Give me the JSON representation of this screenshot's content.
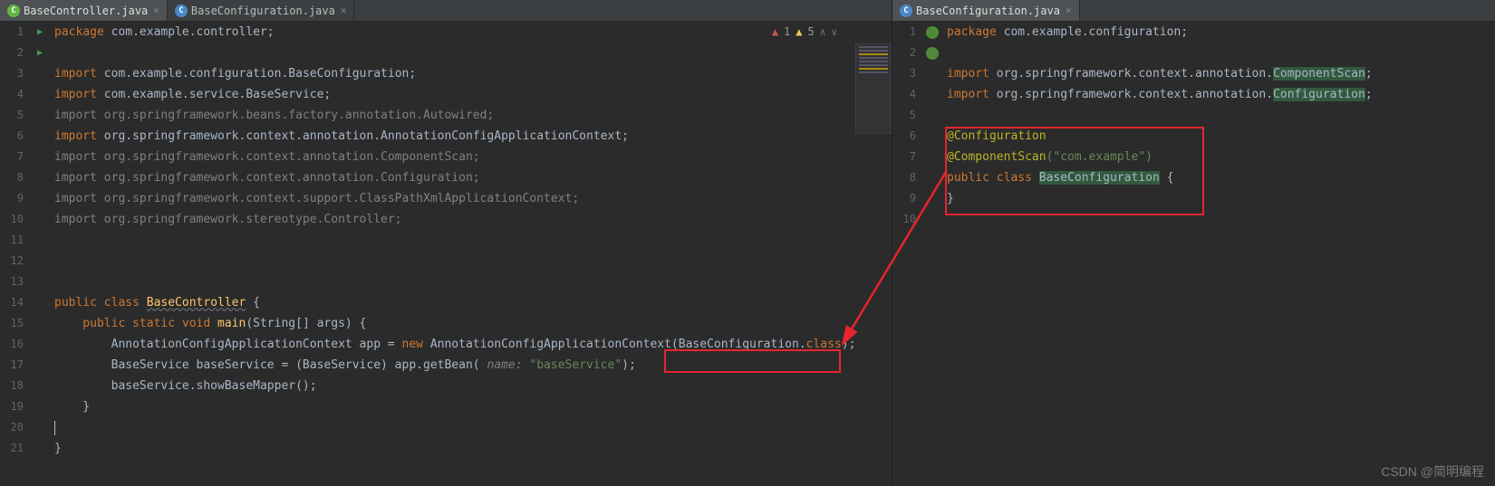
{
  "watermark": "CSDN @简明编程",
  "left": {
    "tabs": [
      {
        "label": "BaseController.java",
        "icon": "green",
        "active": true
      },
      {
        "label": "BaseConfiguration.java",
        "icon": "blue",
        "active": false
      }
    ],
    "warnings": {
      "errors": "1",
      "warns": "5"
    },
    "gutter": [
      "1",
      "2",
      "3",
      "4",
      "5",
      "6",
      "7",
      "8",
      "9",
      "10",
      "11",
      "12",
      "13",
      "14",
      "15",
      "16",
      "17",
      "18",
      "19",
      "20",
      "21"
    ],
    "lines": {
      "l1_kw": "package",
      "l1_rest": " com.example.controller;",
      "l3_kw": "import",
      "l3_rest": " com.example.configuration.BaseConfiguration;",
      "l4_kw": "import",
      "l4_rest": " com.example.service.BaseService;",
      "l5": "import org.springframework.beans.factory.annotation.Autowired;",
      "l6_kw": "import",
      "l6_rest": " org.springframework.context.annotation.AnnotationConfigApplicationContext;",
      "l7": "import org.springframework.context.annotation.ComponentScan;",
      "l8": "import org.springframework.context.annotation.Configuration;",
      "l9": "import org.springframework.context.support.ClassPathXmlApplicationContext;",
      "l10": "import org.springframework.stereotype.Controller;",
      "l14_pub": "public class ",
      "l14_cls": "BaseController",
      "l14_end": " {",
      "l15_pub": "    public static void ",
      "l15_main": "main",
      "l15_args": "(String[] args) {",
      "l16_a": "        AnnotationConfigApplicationContext app = ",
      "l16_new": "new",
      "l16_b": " AnnotationConfigApplicationContext(BaseConfiguration.",
      "l16_cls": "class",
      "l16_c": ");",
      "l17_a": "        BaseService baseService = (BaseService) app.getBean( ",
      "l17_p": "name:",
      "l17_s": " \"baseService\"",
      "l17_e": ");",
      "l18": "        baseService.showBaseMapper();",
      "l19": "    }",
      "l21": "}"
    }
  },
  "right": {
    "tabs": [
      {
        "label": "BaseConfiguration.java",
        "icon": "blue",
        "active": true
      }
    ],
    "gutter": [
      "1",
      "2",
      "3",
      "4",
      "5",
      "6",
      "7",
      "8",
      "9",
      "10"
    ],
    "lines": {
      "l1_kw": "package",
      "l1_rest": " com.example.configuration;",
      "l3_kw": "import",
      "l3_a": " org.springframework.context.annotation.",
      "l3_b": "ComponentScan",
      "l3_c": ";",
      "l4_kw": "import",
      "l4_a": " org.springframework.context.annotation.",
      "l4_b": "Configuration",
      "l4_c": ";",
      "l6": "@Configuration",
      "l7_a": "@ComponentScan",
      "l7_s": "(\"com.example\")",
      "l8_pub": "public class ",
      "l8_cls": "BaseConfiguration",
      "l8_end": " {",
      "l9": "}"
    }
  }
}
